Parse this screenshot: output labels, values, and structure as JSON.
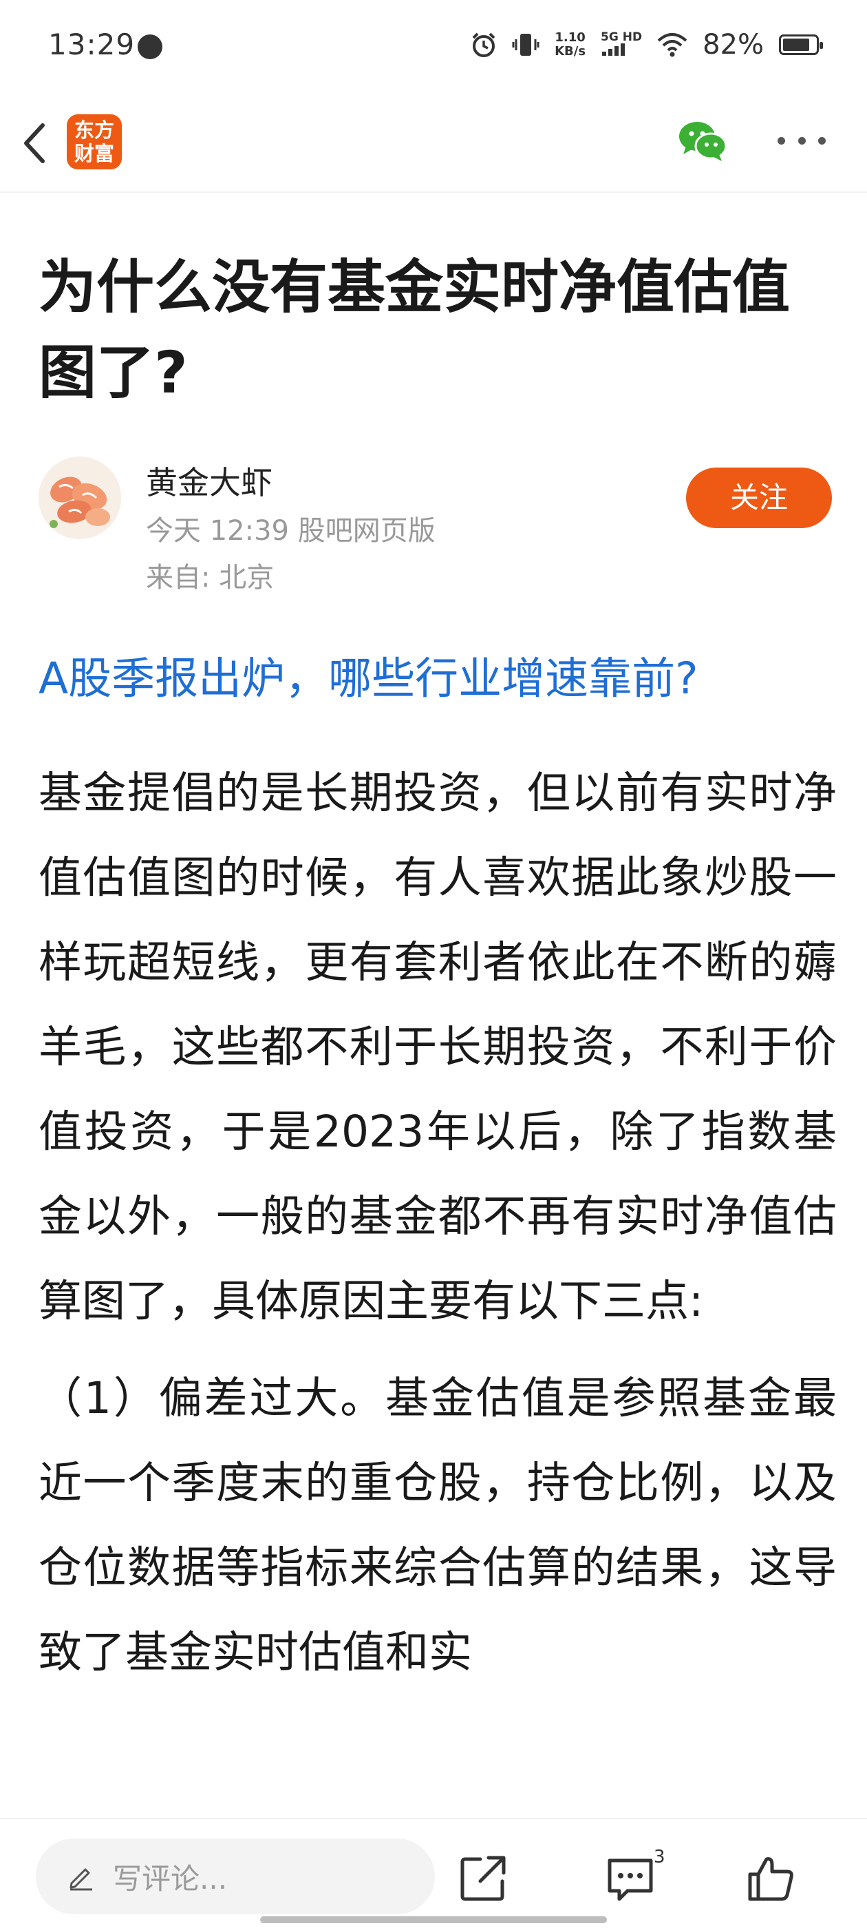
{
  "status_bar": {
    "time": "13:29",
    "net_speed_value": "1.10",
    "net_speed_unit": "KB/s",
    "signal_label": "5G HD",
    "battery_percent": "82%",
    "battery_level": 0.82
  },
  "header": {
    "brand_line1": "东方",
    "brand_line2": "财富",
    "brand_color": "#ee5a14"
  },
  "article": {
    "title": "为什么没有基金实时净值估值图了?",
    "author": {
      "name": "黄金大虾",
      "meta": "今天 12:39 股吧网页版",
      "from": "来自: 北京",
      "follow_label": "关注"
    },
    "promo_link": "A股季报出炉，哪些行业增速靠前?",
    "paragraphs": [
      "基金提倡的是长期投资，但以前有实时净值估值图的时候，有人喜欢据此象炒股一样玩超短线，更有套利者依此在不断的薅羊毛，这些都不利于长期投资，不利于价值投资，于是2023年以后，除了指数基金以外，一般的基金都不再有实时净值估算图了，具体原因主要有以下三点:",
      "（1）偏差过大。基金估值是参照基金最近一个季度末的重仓股，持仓比例，以及仓位数据等指标来综合估算的结果，这导致了基金实时估值和实"
    ]
  },
  "toolbar": {
    "comment_placeholder": "写评论...",
    "comment_count": "3"
  }
}
